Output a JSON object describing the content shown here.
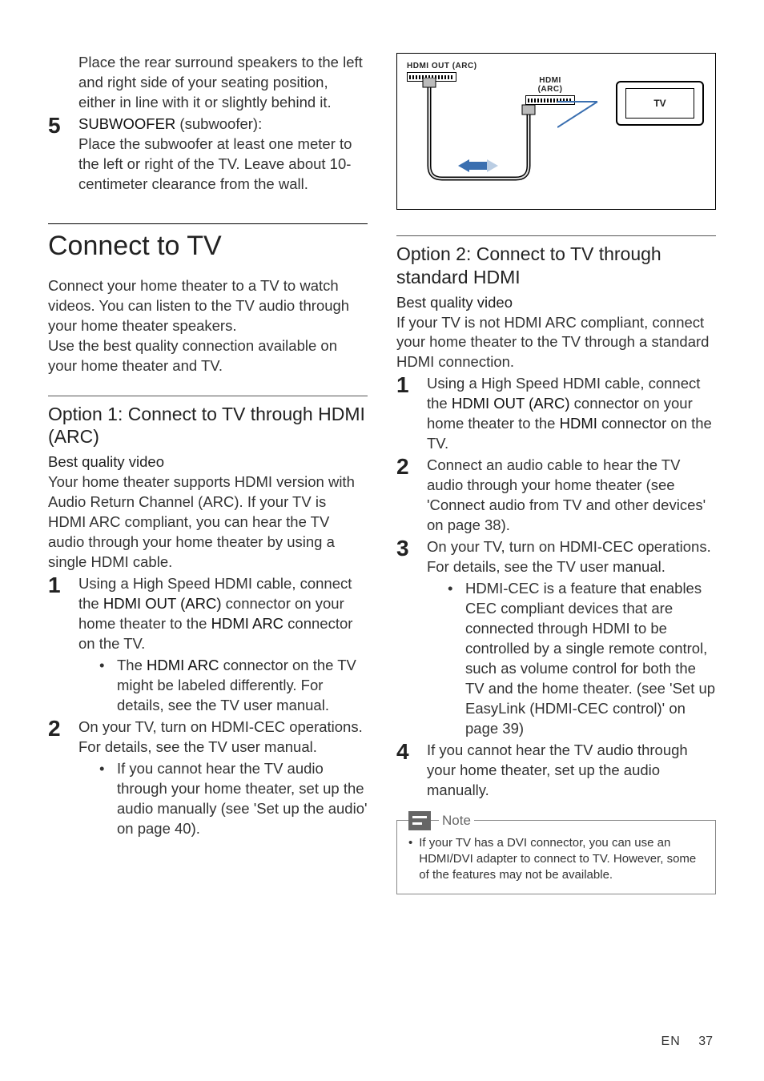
{
  "left": {
    "speaker_para": "Place the rear surround speakers to the left and right side of your seating position, either in line with it or slightly behind it.",
    "step5_num": "5",
    "step5_label": "SUBWOOFER",
    "step5_paren": "(subwoofer):",
    "step5_body": "Place the subwoofer at least one meter to the left or right of the TV. Leave about 10-centimeter clearance from the wall.",
    "h1": "Connect to TV",
    "intro1": "Connect your home theater to a TV to watch videos. You can listen to the TV audio through your home theater speakers.",
    "intro2": "Use the best quality connection available on your home theater and TV.",
    "opt1_h2": "Option 1: Connect to TV through HDMI (ARC)",
    "opt1_h3": "Best quality video",
    "opt1_para": "Your home theater supports HDMI version with Audio Return Channel (ARC). If your TV is HDMI ARC compliant, you can hear the TV audio through your home theater by using a single HDMI cable.",
    "opt1_s1_num": "1",
    "opt1_s1_a": "Using a High Speed HDMI cable, connect the ",
    "opt1_s1_b": "HDMI OUT (ARC)",
    "opt1_s1_c": " connector on your home theater to the ",
    "opt1_s1_d": "HDMI ARC",
    "opt1_s1_e": " connector on the TV.",
    "opt1_s1_bullet_a": "The ",
    "opt1_s1_bullet_b": "HDMI ARC",
    "opt1_s1_bullet_c": " connector on the TV might be labeled differently. For details, see the TV user manual.",
    "opt1_s2_num": "2",
    "opt1_s2": "On your TV, turn on HDMI-CEC operations. For details, see the TV user manual.",
    "opt1_s2_bullet": "If you cannot hear the TV audio through your home theater, set up the audio manually (see 'Set up the audio' on page 40)."
  },
  "right": {
    "diag_label1": "HDMI OUT (ARC)",
    "diag_label2_a": "HDMI",
    "diag_label2_b": "(ARC)",
    "diag_tv": "TV",
    "opt2_h2": "Option 2: Connect to TV through standard HDMI",
    "opt2_h3": "Best quality video",
    "opt2_para": "If your TV is not HDMI ARC compliant, connect your home theater to the TV through a standard HDMI connection.",
    "opt2_s1_num": "1",
    "opt2_s1_a": "Using a High Speed HDMI cable, connect the ",
    "opt2_s1_b": "HDMI OUT (ARC)",
    "opt2_s1_c": " connector on your home theater to the ",
    "opt2_s1_d": "HDMI",
    "opt2_s1_e": " connector on the TV.",
    "opt2_s2_num": "2",
    "opt2_s2": "Connect an audio cable to hear the TV audio through your home theater (see 'Connect audio from TV and other devices' on page 38).",
    "opt2_s3_num": "3",
    "opt2_s3": "On your TV, turn on HDMI-CEC operations. For details, see the TV user manual.",
    "opt2_s3_bullet": "HDMI-CEC is a feature that enables CEC compliant devices that are connected through HDMI to be controlled by a single remote control, such as volume control for both the TV and the home theater. (see 'Set up EasyLink (HDMI-CEC control)' on page 39)",
    "opt2_s4_num": "4",
    "opt2_s4": "If you cannot hear the TV audio through your home theater, set up the audio manually.",
    "note_title": "Note",
    "note_body": "If your TV has a DVI connector, you can use an HDMI/DVI adapter to connect to TV. However, some of the features may not be available."
  },
  "footer": {
    "lang": "EN",
    "page": "37"
  }
}
